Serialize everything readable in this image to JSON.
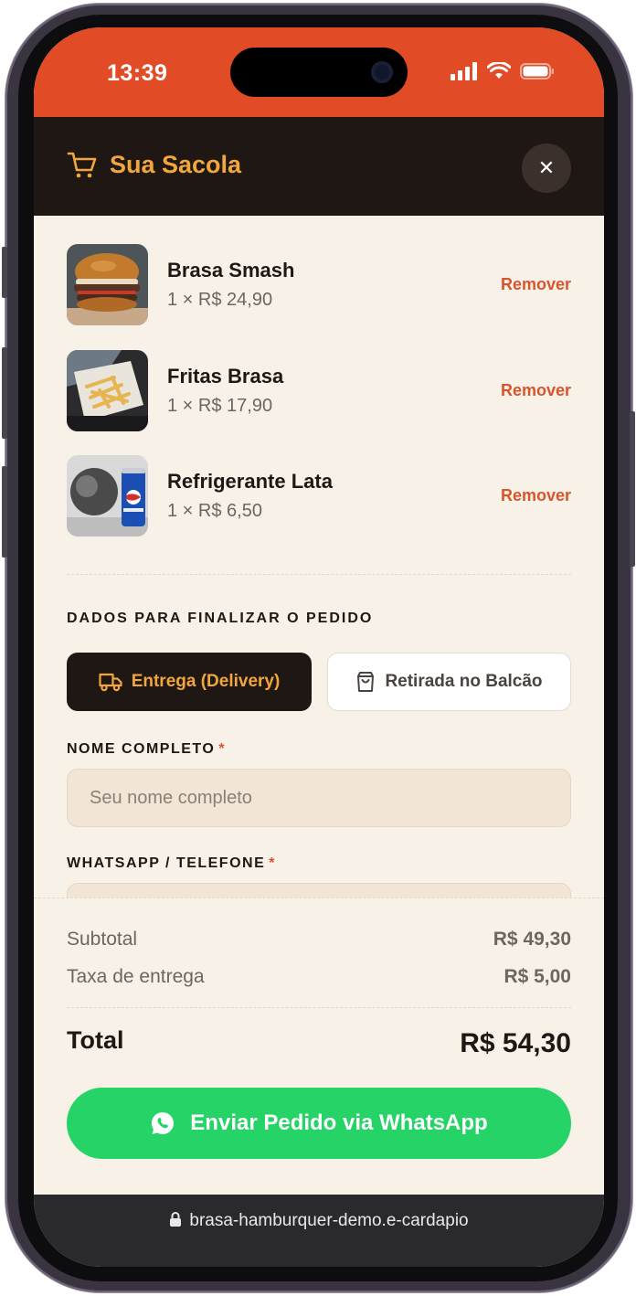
{
  "status_bar": {
    "time": "13:39"
  },
  "header": {
    "title": "Sua Sacola",
    "close_label": "✕"
  },
  "cart": {
    "items": [
      {
        "name": "Brasa Smash",
        "price": "1 × R$ 24,90",
        "remove_label": "Remover"
      },
      {
        "name": "Fritas Brasa",
        "price": "1 × R$ 17,90",
        "remove_label": "Remover"
      },
      {
        "name": "Refrigerante Lata",
        "price": "1 × R$ 6,50",
        "remove_label": "Remover"
      }
    ]
  },
  "checkout": {
    "section_title": "DADOS PARA FINALIZAR O PEDIDO",
    "delivery_label": "Entrega (Delivery)",
    "pickup_label": "Retirada no Balcão",
    "name_label": "NOME COMPLETO",
    "name_placeholder": "Seu nome completo",
    "phone_label": "WHATSAPP / TELEFONE",
    "required_mark": "*"
  },
  "summary": {
    "subtotal_label": "Subtotal",
    "subtotal_value": "R$ 49,30",
    "fee_label": "Taxa de entrega",
    "fee_value": "R$ 5,00",
    "total_label": "Total",
    "total_value": "R$ 54,30",
    "send_label": "Enviar Pedido via WhatsApp"
  },
  "browser": {
    "url": "brasa-hamburquer-demo.e-cardapio"
  },
  "colors": {
    "status_bar": "#e14b25",
    "header_bg": "#1f1714",
    "accent": "#f2a73b",
    "remove": "#d9542d",
    "whatsapp": "#25d366",
    "page_bg": "#f7f1e7"
  },
  "icons": [
    "cart-icon",
    "close-icon",
    "truck-icon",
    "bag-icon",
    "whatsapp-icon",
    "lock-icon",
    "signal-icon",
    "wifi-icon",
    "battery-icon"
  ]
}
